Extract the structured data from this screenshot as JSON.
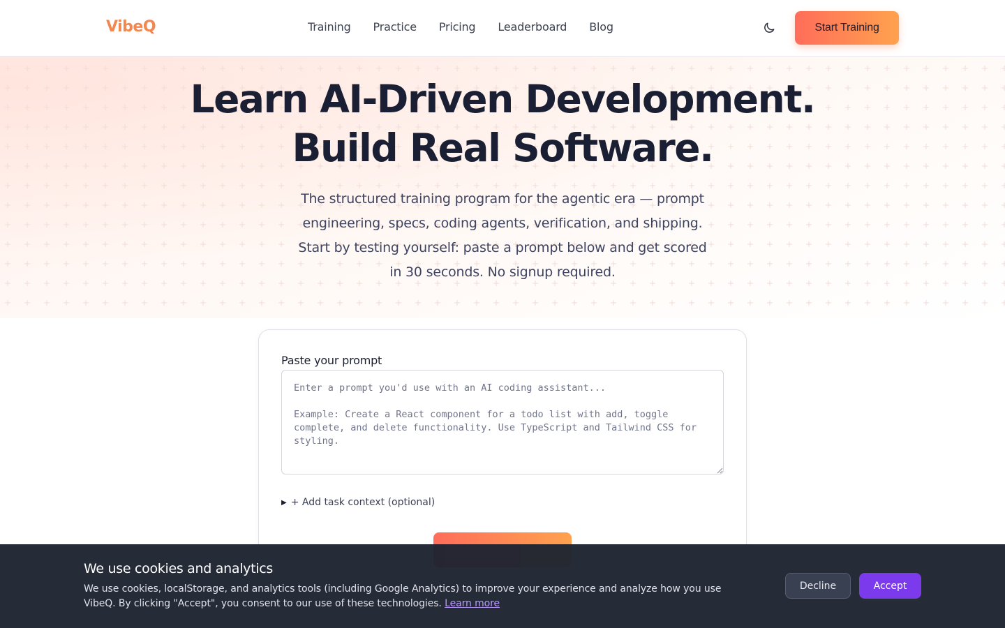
{
  "nav": {
    "logo": "VibeQ",
    "links": [
      "Training",
      "Practice",
      "Pricing",
      "Leaderboard",
      "Blog"
    ],
    "theme_toggle_icon": "moon-icon",
    "cta_label": "Start Training"
  },
  "hero": {
    "title_line1": "Learn AI-Driven Development.",
    "title_line2": "Build Real Software.",
    "subtitle": "The structured training program for the agentic era — prompt engineering, specs, coding agents, verification, and shipping. Start by testing yourself: paste a prompt below and get scored in 30 seconds. No signup required."
  },
  "prompt_card": {
    "label": "Paste your prompt",
    "input_value": "",
    "placeholder": "Enter a prompt you'd use with an AI coding assistant...\n\nExample: Create a React component for a todo list with add, toggle complete, and delete functionality. Use TypeScript and Tailwind CSS for styling.",
    "context_toggle": "+ Add task context (optional)",
    "submit_label": ""
  },
  "cookie_banner": {
    "title": "We use cookies and analytics",
    "text": "We use cookies, localStorage, and analytics tools (including Google Analytics) to improve your experience and analyze how you use VibeQ. By clicking \"Accept\", you consent to our use of these technologies.",
    "link_label": "Learn more",
    "decline_label": "Decline",
    "accept_label": "Accept"
  },
  "colors": {
    "brand": "#f2874f",
    "gradient_start": "#ff6d5a",
    "gradient_end": "#ffa24e",
    "accept": "#7c3aed",
    "banner_bg": "#1f2432"
  }
}
